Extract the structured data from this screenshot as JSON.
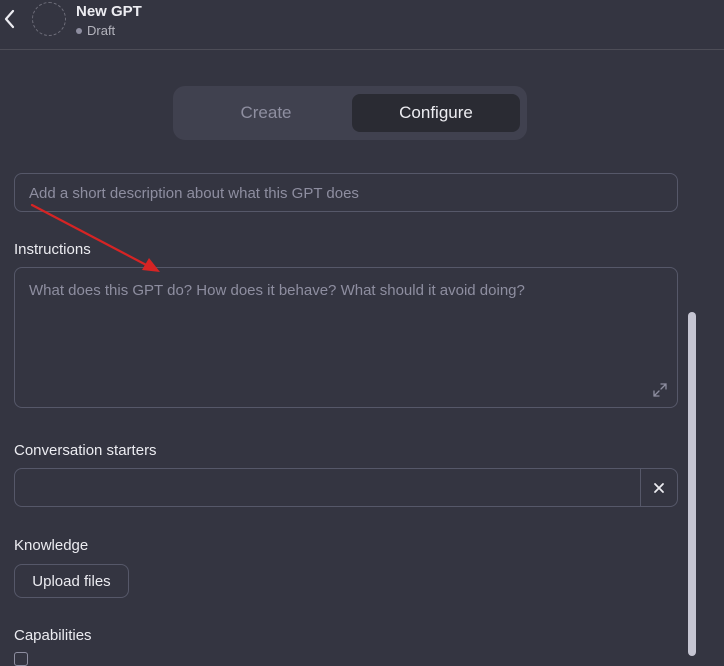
{
  "header": {
    "title": "New GPT",
    "status": "Draft",
    "back_icon": "chevron-left-icon"
  },
  "tabs": [
    {
      "label": "Create",
      "active": false
    },
    {
      "label": "Configure",
      "active": true
    }
  ],
  "description": {
    "placeholder": "Add a short description about what this GPT does"
  },
  "instructions": {
    "label": "Instructions",
    "placeholder": "What does this GPT do? How does it behave? What should it avoid doing?"
  },
  "conversation_starters": {
    "label": "Conversation starters",
    "value": ""
  },
  "knowledge": {
    "label": "Knowledge",
    "upload_label": "Upload files"
  },
  "capabilities": {
    "label": "Capabilities"
  },
  "colors": {
    "background": "#343541",
    "annotation_arrow": "#d62424"
  }
}
